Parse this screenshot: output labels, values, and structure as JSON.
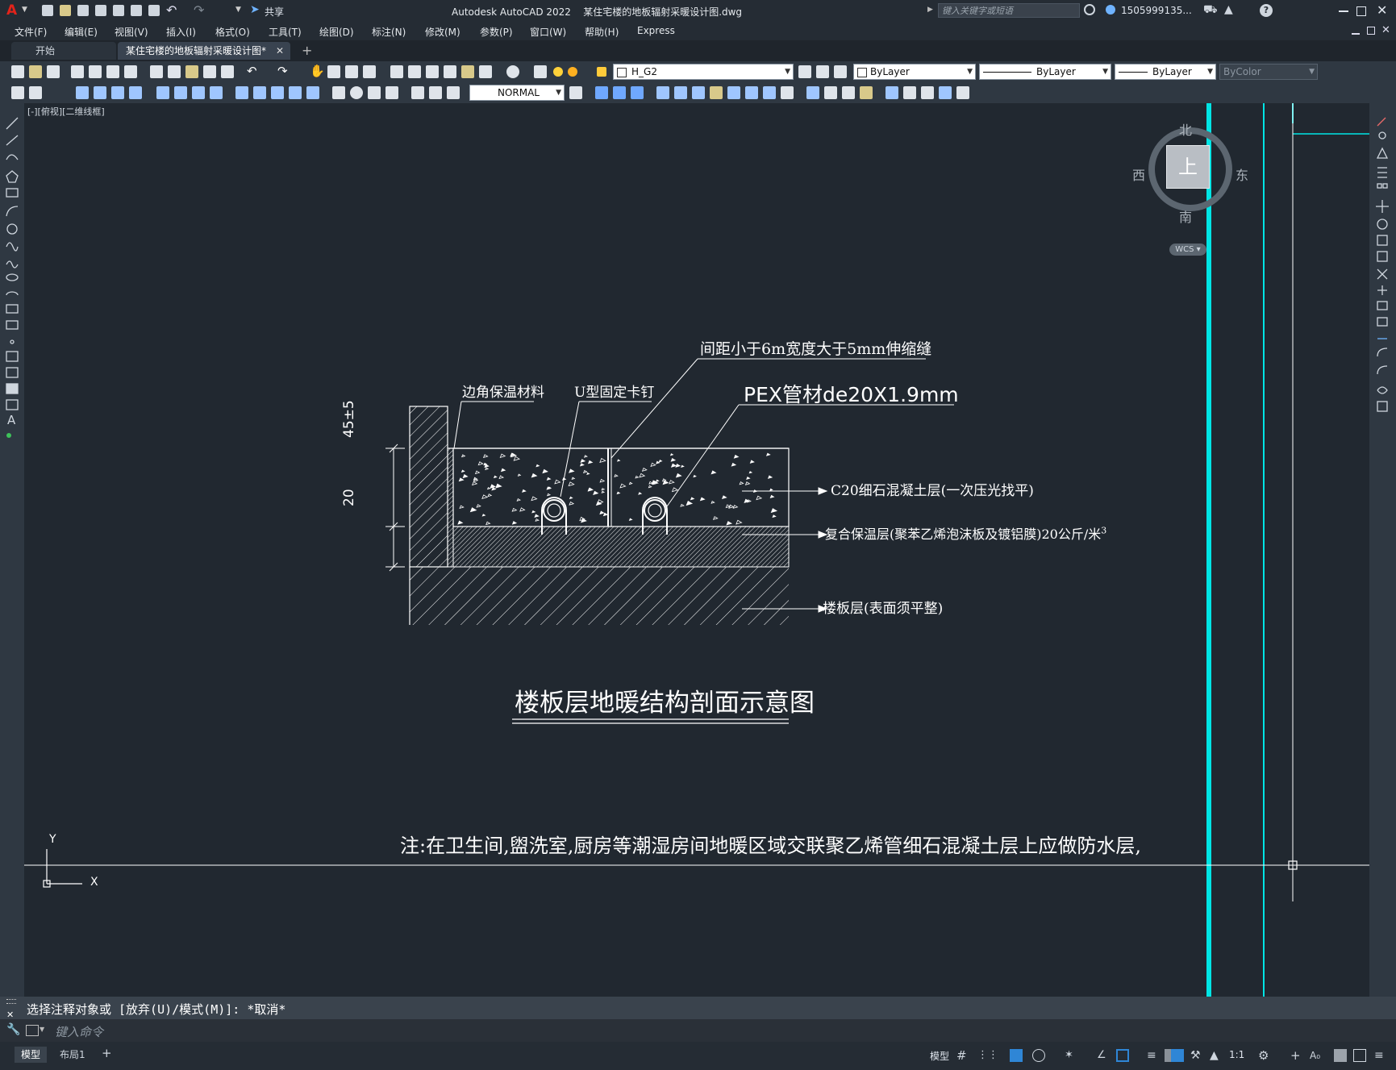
{
  "app": {
    "title": "Autodesk AutoCAD 2022",
    "file_name": "某住宅楼的地板辐射采暖设计图.dwg",
    "share_label": "共享",
    "search_placeholder": "键入关键字或短语",
    "user_label": "1505999135..."
  },
  "menu": [
    "文件(F)",
    "编辑(E)",
    "视图(V)",
    "插入(I)",
    "格式(O)",
    "工具(T)",
    "绘图(D)",
    "标注(N)",
    "修改(M)",
    "参数(P)",
    "窗口(W)",
    "帮助(H)",
    "Express"
  ],
  "tabs": {
    "start_label": "开始",
    "drawing_label": "某住宅楼的地板辐射采暖设计图*"
  },
  "toolbar": {
    "layer_value": "H_G2",
    "color_value": "ByLayer",
    "linetype_value": "ByLayer",
    "lineweight_value": "ByLayer",
    "plotstyle_value": "ByColor",
    "textstyle_value": "NORMAL"
  },
  "viewport_label": "[-][俯视][二维线框]",
  "viewcube": {
    "north": "北",
    "south": "南",
    "east": "东",
    "west": "西",
    "face": "上",
    "wcs": "WCS"
  },
  "drawing": {
    "label_expansion_joint": "间距小于6m宽度大于5mm伸缩缝",
    "label_corner_insulation": "边角保温材料",
    "label_u_clip": "U型固定卡钉",
    "label_pex": "PEX管材de20X1.9mm",
    "label_c20": "C20细石混凝土层(一次压光找平)",
    "label_insulation_layer": "复合保温层(聚苯乙烯泡沫板及镀铝膜)20公斤/米",
    "label_insulation_superscript": "3",
    "label_floor_slab": "楼板层(表面须平整)",
    "dim_top": "45±5",
    "dim_bottom": "20",
    "title": "楼板层地暖结构剖面示意图",
    "note": "注:在卫生间,盥洗室,厨房等潮湿房间地暖区域交联聚乙烯管细石混凝土层上应做防水层,",
    "ucs_x": "X",
    "ucs_y": "Y"
  },
  "command": {
    "history": "选择注释对象或 [放弃(U)/模式(M)]: *取消*",
    "input_placeholder": "键入命令"
  },
  "status": {
    "model_tab": "模型",
    "layout_tab": "布局1",
    "model_space": "模型",
    "scale": "1:1"
  },
  "colors": {
    "canvas": "#212830",
    "cyan_line": "#00e5e5",
    "line_white": "#ffffff",
    "accent": "#2f86d6"
  }
}
